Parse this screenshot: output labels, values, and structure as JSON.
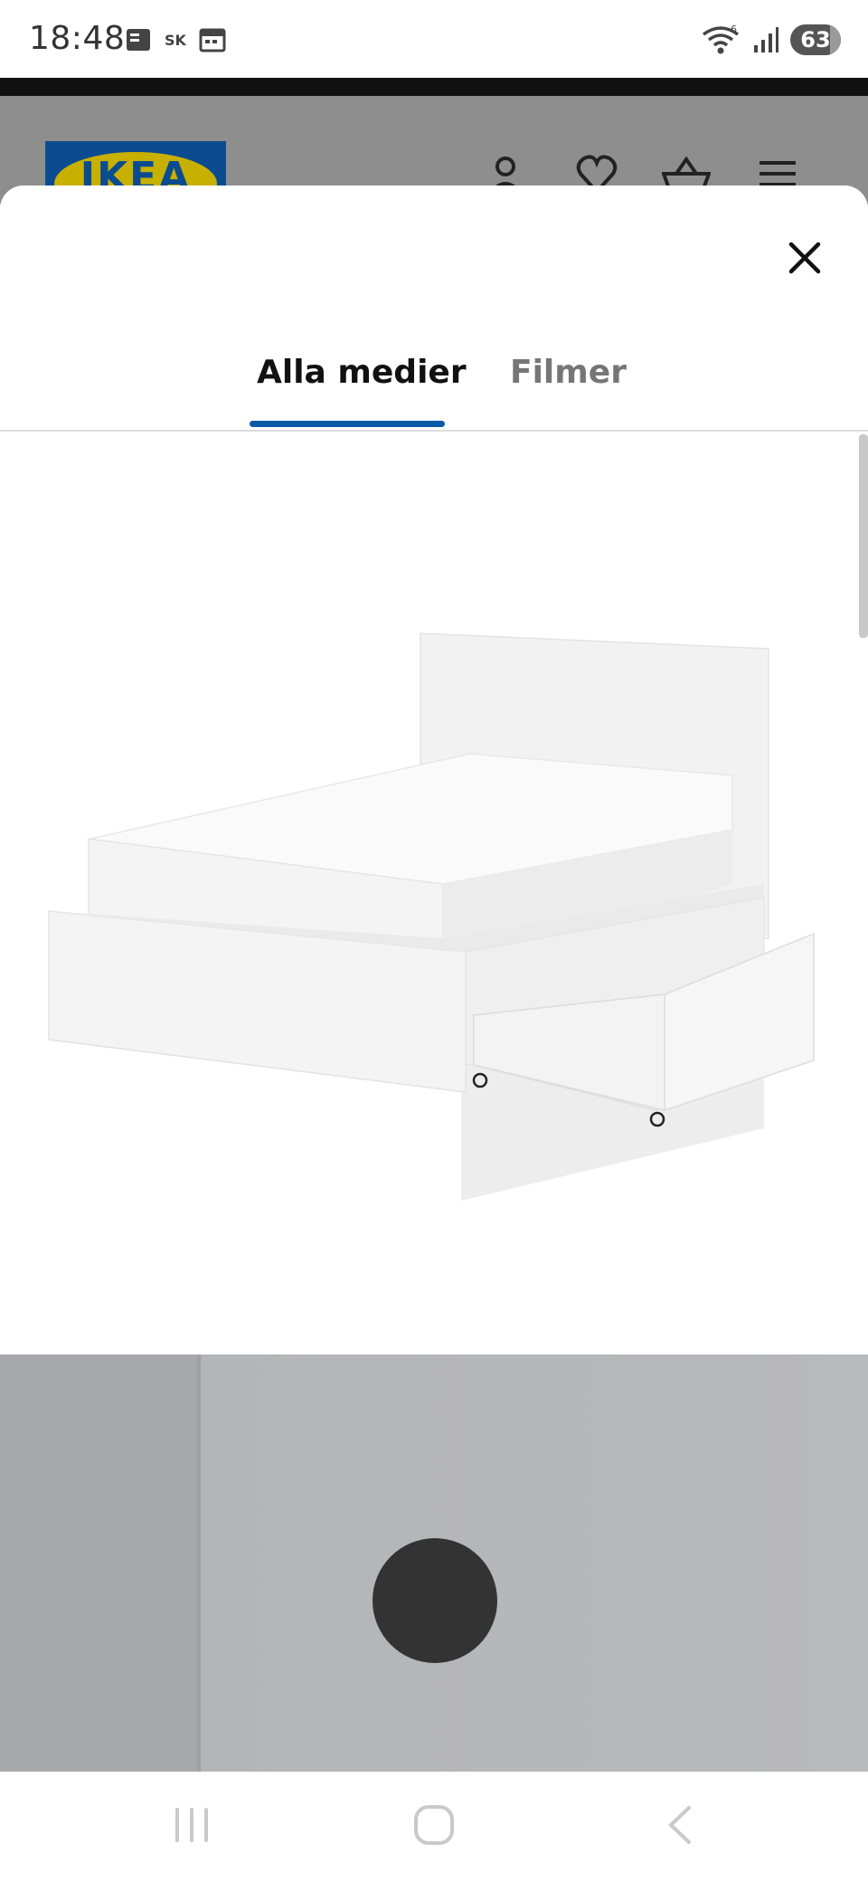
{
  "status_bar": {
    "time": "18:48",
    "battery": "63",
    "left_icons": [
      "notification-icon",
      "sync-icon",
      "calendar-icon"
    ],
    "right_icons": [
      "wifi-icon",
      "signal-icon",
      "battery-icon"
    ]
  },
  "header": {
    "logo_text": "IKEA",
    "icons": [
      "account-icon",
      "heart-icon",
      "cart-icon",
      "menu-icon"
    ]
  },
  "modal": {
    "close_icon": "close-icon",
    "tabs": [
      {
        "label": "Alla medier",
        "active": true
      },
      {
        "label": "Filmer",
        "active": false
      }
    ]
  },
  "media": [
    {
      "name": "bed-image"
    },
    {
      "name": "room-image"
    }
  ],
  "navigation": {
    "icons": [
      "recents-icon",
      "home-icon",
      "back-icon"
    ]
  },
  "colors": {
    "accent": "#0a5aa8",
    "ikea_blue": "#0a4c8f",
    "ikea_yellow": "#c8b000"
  }
}
